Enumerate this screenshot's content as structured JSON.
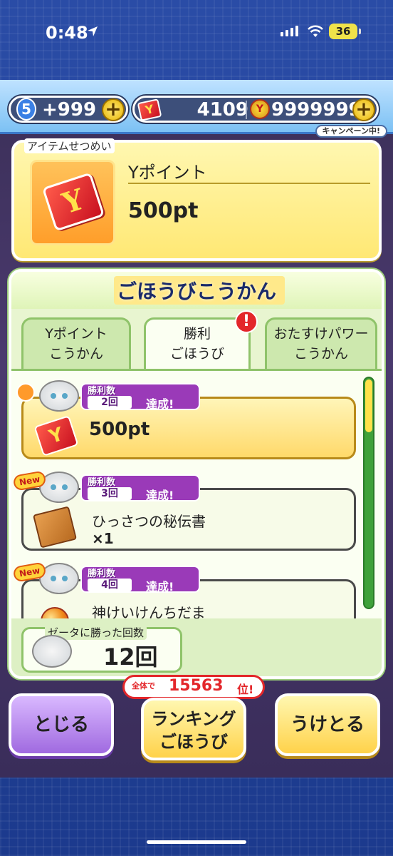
{
  "status_bar": {
    "time": "0:48",
    "battery": "36"
  },
  "currency": {
    "stamina_level": "5",
    "stamina_value": "+999",
    "y_points": "4109",
    "money": "9999999",
    "campaign_label": "キャンペーン中!"
  },
  "item_detail": {
    "section_label": "アイテムせつめい",
    "name": "Yポイント",
    "value": "500pt",
    "y_glyph": "Y"
  },
  "reward_exchange": {
    "title": "ごほうびこうかん",
    "tabs": [
      {
        "label_line1": "Yポイント",
        "label_line2": "こうかん"
      },
      {
        "label_line1": "勝利",
        "label_line2": "ごほうび"
      },
      {
        "label_line1": "おたすけパワー",
        "label_line2": "こうかん"
      }
    ],
    "tab_alert": "!",
    "rows": [
      {
        "win_label": "勝利数",
        "win_count": "2回",
        "status": "達成!",
        "reward": "500pt",
        "badge": ""
      },
      {
        "win_label": "勝利数",
        "win_count": "3回",
        "status": "達成!",
        "reward": "ひっさつの秘伝書",
        "qty": "×1",
        "badge": "New"
      },
      {
        "win_label": "勝利数",
        "win_count": "4回",
        "status": "達成!",
        "reward": "神けいけんちだま",
        "badge": "New"
      }
    ],
    "scroll_progress": 0.22,
    "total_label": "ゼータに勝った回数",
    "total_value": "12回"
  },
  "buttons": {
    "close": "とじる",
    "ranking_line1": "ランキング",
    "ranking_line2": "ごほうび",
    "receive": "うけとる"
  },
  "ranking": {
    "prefix": "全体で",
    "rank": "15563",
    "suffix": "位!"
  },
  "colors": {
    "frame_blue": "#1f3f94",
    "panel_yellow": "#ffe874",
    "panel_green": "#e8f5d0",
    "accent_purple": "#9a3ab8",
    "alert_red": "#e3262a"
  }
}
